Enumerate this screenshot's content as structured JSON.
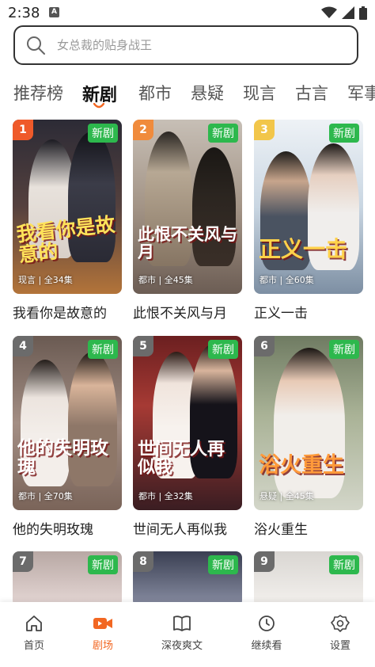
{
  "status": {
    "time": "2:38",
    "notif": "A"
  },
  "search": {
    "placeholder": "女总裁的贴身战王"
  },
  "tabs": [
    "推荐榜",
    "新剧",
    "都市",
    "悬疑",
    "现言",
    "古言",
    "军事"
  ],
  "active_tab": 1,
  "colors": {
    "accent": "#f26722",
    "badge": "#2db84d"
  },
  "cards": [
    {
      "rank": "1",
      "badge": "新剧",
      "poster_title": "我看你是故意的",
      "meta": "现言 | 全34集",
      "title": "我看你是故意的"
    },
    {
      "rank": "2",
      "badge": "新剧",
      "poster_title": "此恨不关风与月",
      "meta": "都市 | 全45集",
      "title": "此恨不关风与月"
    },
    {
      "rank": "3",
      "badge": "新剧",
      "poster_title": "正义一击",
      "meta": "都市 | 全60集",
      "title": "正义一击"
    },
    {
      "rank": "4",
      "badge": "新剧",
      "poster_title": "他的失明玫瑰",
      "meta": "都市 | 全70集",
      "title": "他的失明玫瑰"
    },
    {
      "rank": "5",
      "badge": "新剧",
      "poster_title": "世间无人再似我",
      "meta": "都市 | 全32集",
      "title": "世间无人再似我"
    },
    {
      "rank": "6",
      "badge": "新剧",
      "poster_title": "浴火重生",
      "meta": "悬疑 | 全45集",
      "title": "浴火重生"
    },
    {
      "rank": "7",
      "badge": "新剧"
    },
    {
      "rank": "8",
      "badge": "新剧"
    },
    {
      "rank": "9",
      "badge": "新剧"
    }
  ],
  "nav": [
    {
      "label": "首页",
      "icon": "home-icon"
    },
    {
      "label": "剧场",
      "icon": "video-icon"
    },
    {
      "label": "深夜爽文",
      "icon": "book-icon"
    },
    {
      "label": "继续看",
      "icon": "clock-icon"
    },
    {
      "label": "设置",
      "icon": "gear-icon"
    }
  ]
}
